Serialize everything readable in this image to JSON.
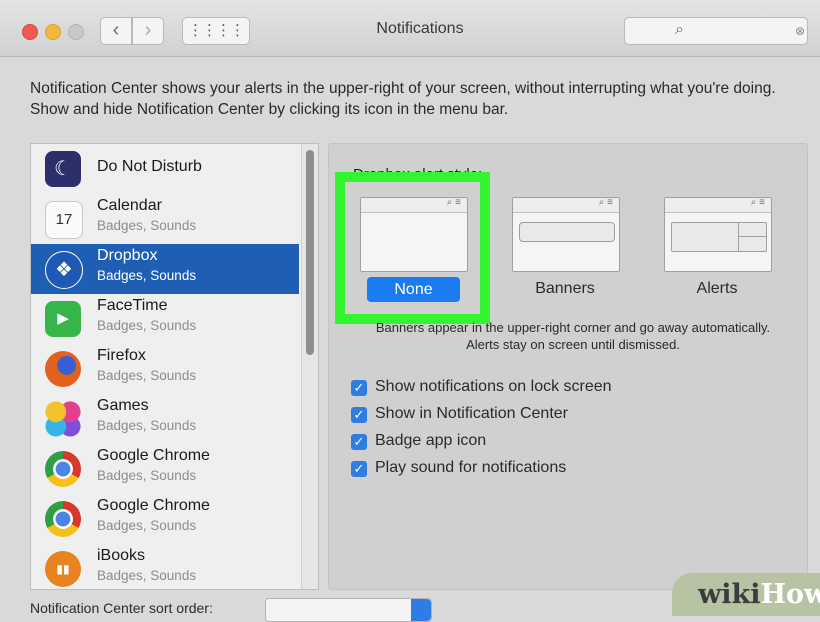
{
  "window": {
    "title": "Notifications",
    "back_icon": "‹",
    "forward_icon": "›",
    "grid_icon": "⋮⋮⋮⋮",
    "search_icon": "⌕",
    "search_clear": "⊗"
  },
  "description": "Notification Center shows your alerts in the upper-right of your screen, without interrupting what you're doing. Show and hide Notification Center by clicking its icon in the menu bar.",
  "apps": [
    {
      "name": "Do Not Disturb",
      "subtitle": "",
      "icon": "moon-icon",
      "glyph": "☾",
      "color": "#2c2f6b"
    },
    {
      "name": "Calendar",
      "subtitle": "Badges, Sounds",
      "icon": "calendar-icon",
      "glyph": "17",
      "color": "#fafafa"
    },
    {
      "name": "Dropbox",
      "subtitle": "Badges, Sounds",
      "icon": "dropbox-icon",
      "glyph": "❖",
      "color": "#1f59b5"
    },
    {
      "name": "FaceTime",
      "subtitle": "Badges, Sounds",
      "icon": "facetime-icon",
      "glyph": "▶",
      "color": "#36b64a"
    },
    {
      "name": "Firefox",
      "subtitle": "Badges, Sounds",
      "icon": "firefox-icon",
      "glyph": "●",
      "color": "#e3621b"
    },
    {
      "name": "Games",
      "subtitle": "Badges, Sounds",
      "icon": "games-icon",
      "glyph": "●",
      "color": "#c849c9"
    },
    {
      "name": "Google Chrome",
      "subtitle": "Badges, Sounds",
      "icon": "chrome-icon",
      "glyph": "●",
      "color": "#d7372c"
    },
    {
      "name": "Google Chrome",
      "subtitle": "Badges, Sounds",
      "icon": "chrome-icon",
      "glyph": "●",
      "color": "#d7372c"
    },
    {
      "name": "iBooks",
      "subtitle": "Badges, Sounds",
      "icon": "ibooks-icon",
      "glyph": "▮▮",
      "color": "#e8841f"
    }
  ],
  "selected_app_index": 2,
  "alert_style": {
    "label": "Dropbox alert style:",
    "options": [
      "None",
      "Banners",
      "Alerts"
    ],
    "selected": "None",
    "preview_icons": "⌕ ≡"
  },
  "info": "Banners appear in the upper-right corner and go away automatically. Alerts stay on screen until dismissed.",
  "checkboxes": [
    {
      "label": "Show notifications on lock screen",
      "checked": true
    },
    {
      "label": "Show in Notification Center",
      "checked": true
    },
    {
      "label": "Badge app icon",
      "checked": true
    },
    {
      "label": "Play sound for notifications",
      "checked": true
    }
  ],
  "bottom": {
    "label": "Notification Center sort order:"
  },
  "watermark": {
    "part1": "wiki",
    "part2": "How"
  },
  "colors": {
    "highlight": "#33f52f",
    "selection": "#1e5fb4",
    "accent": "#1a7cf0"
  }
}
